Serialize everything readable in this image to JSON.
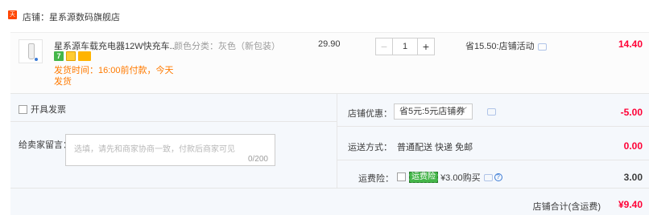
{
  "store": {
    "badge": "天猫",
    "name": "店铺：星系源数码旗舰店"
  },
  "item": {
    "title": "星系源车载充电器12W快充车...",
    "spec": "颜色分类：灰色（新包装）",
    "shipping_note": "发货时间：16:00前付款，今天发货",
    "unit_price": "29.90",
    "quantity": "1",
    "minus_label": "−",
    "plus_label": "+",
    "save_note": "省15.50:店铺活动",
    "total": "14.40",
    "promo_seven": "7",
    "accent_color": "#ff0036"
  },
  "order_options": {
    "invoice_label": "开具发票",
    "memo_label": "给卖家留言：",
    "memo_placeholder": "选填，请先和商家协商一致，付款后商家可见",
    "memo_count": "0/200"
  },
  "summary": {
    "coupon_label": "店铺优惠：",
    "coupon_value": "省5元:5元店铺券",
    "coupon_amount": "-5.00",
    "shipping_label": "运送方式：",
    "shipping_value": "普通配送 快递 免邮",
    "shipping_amount": "0.00",
    "insurance_label": "运费险：",
    "insurance_tag": "运费险",
    "insurance_text": "¥3.00购买",
    "insurance_amount": "3.00",
    "help_glyph": "?"
  },
  "footer": {
    "label": "店铺合计(含运费)",
    "total": "¥9.40"
  }
}
